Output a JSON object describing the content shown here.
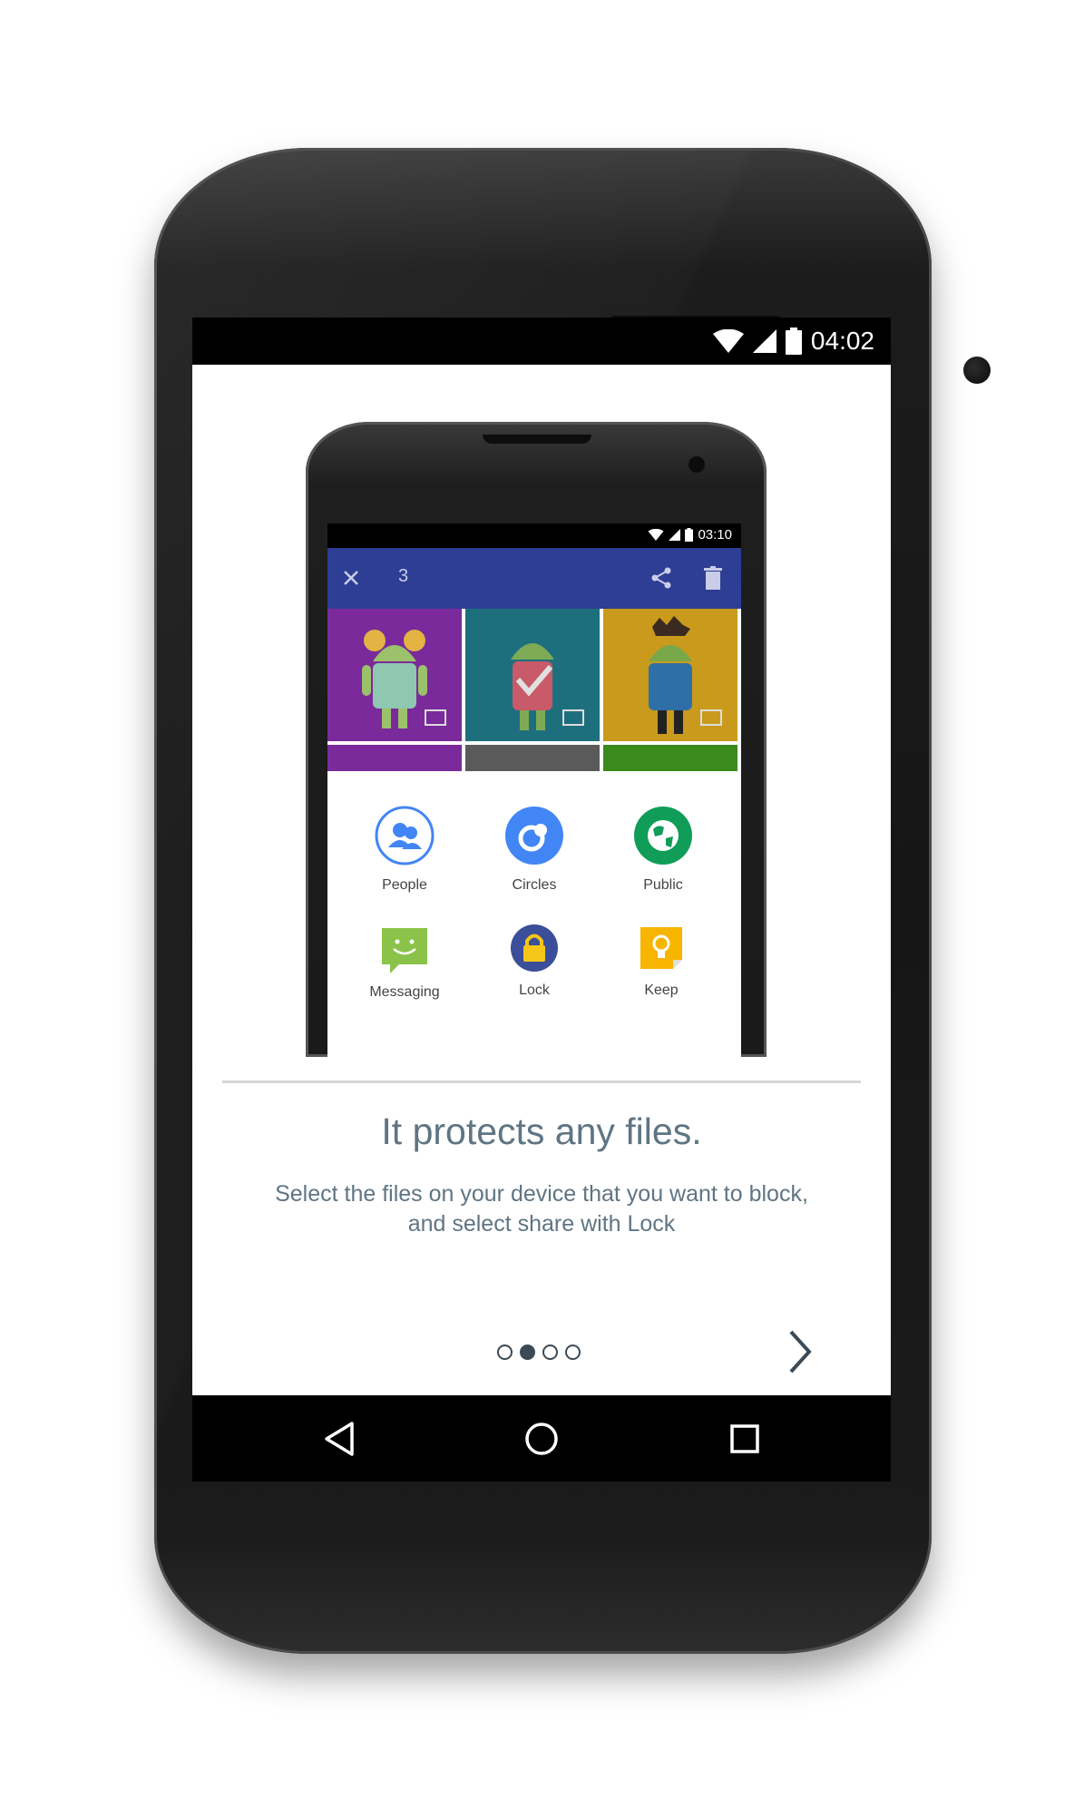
{
  "status_bar": {
    "time": "04:02"
  },
  "illustration": {
    "status_time": "03:10",
    "toolbar_count": "3",
    "share_items": [
      {
        "label": "People",
        "icon": "people-icon"
      },
      {
        "label": "Circles",
        "icon": "circles-icon"
      },
      {
        "label": "Public",
        "icon": "public-globe-icon"
      },
      {
        "label": "Messaging",
        "icon": "messaging-icon"
      },
      {
        "label": "Lock",
        "icon": "lock-icon"
      },
      {
        "label": "Keep",
        "icon": "keep-icon"
      }
    ]
  },
  "onboarding": {
    "title": "It protects any files.",
    "description_line1": "Select the files on your device that you want to block,",
    "description_line2": "and select share with Lock",
    "page_count": 4,
    "active_page": 2
  },
  "colors": {
    "text": "#5f7583",
    "toolbar": "#2d3e94",
    "people_blue": "#4285f4",
    "public_green": "#0f9d58",
    "messaging_green": "#8bc34a",
    "lock_navy": "#3a4e99",
    "keep_yellow": "#f7b500"
  }
}
